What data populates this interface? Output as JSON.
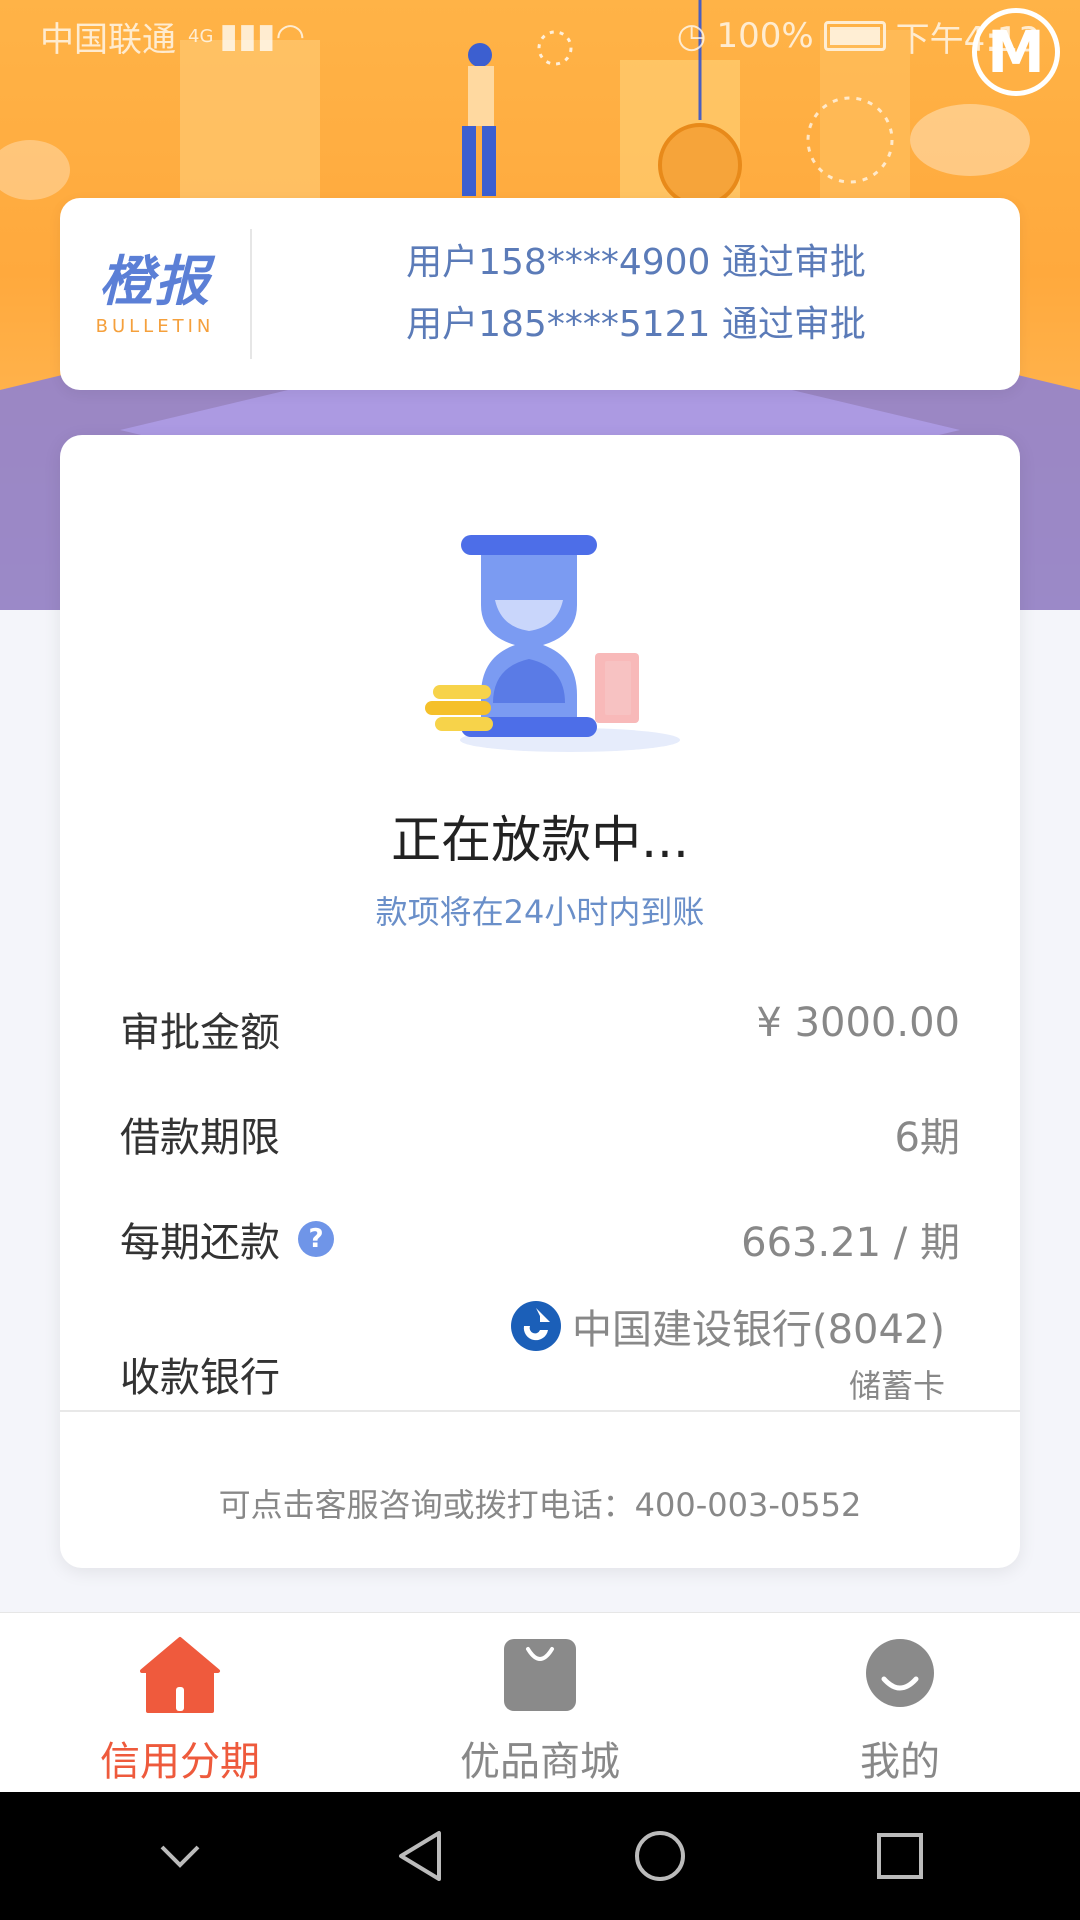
{
  "status_bar": {
    "carrier": "中国联通",
    "network": "4G",
    "battery": "100%",
    "time": "下午4:13"
  },
  "bulletin": {
    "logo_cn": "橙报",
    "logo_en": "BULLETIN",
    "messages": [
      "用户158****4900 通过审批",
      "用户185****5121 通过审批"
    ]
  },
  "loan_status": {
    "title": "正在放款中...",
    "subtitle": "款项将在24小时内到账"
  },
  "details": {
    "amount_label": "审批金额",
    "amount_value": "¥ 3000.00",
    "term_label": "借款期限",
    "term_value": "6期",
    "installment_label": "每期还款",
    "installment_help": "?",
    "installment_value": "663.21 / 期",
    "bank_label": "收款银行",
    "bank_name": "中国建设银行(8042)",
    "bank_card_type": "储蓄卡"
  },
  "service_text": "可点击客服咨询或拨打电话：400-003-0552",
  "bottom_nav": {
    "items": [
      {
        "label": "信用分期",
        "icon": "home-icon",
        "active": true
      },
      {
        "label": "优品商城",
        "icon": "shopping-bag-icon",
        "active": false
      },
      {
        "label": "我的",
        "icon": "profile-icon",
        "active": false
      }
    ]
  },
  "colors": {
    "accent_blue": "#5b7bb8",
    "active_nav": "#ee5a3c",
    "hero_orange": "#ffa93d"
  }
}
